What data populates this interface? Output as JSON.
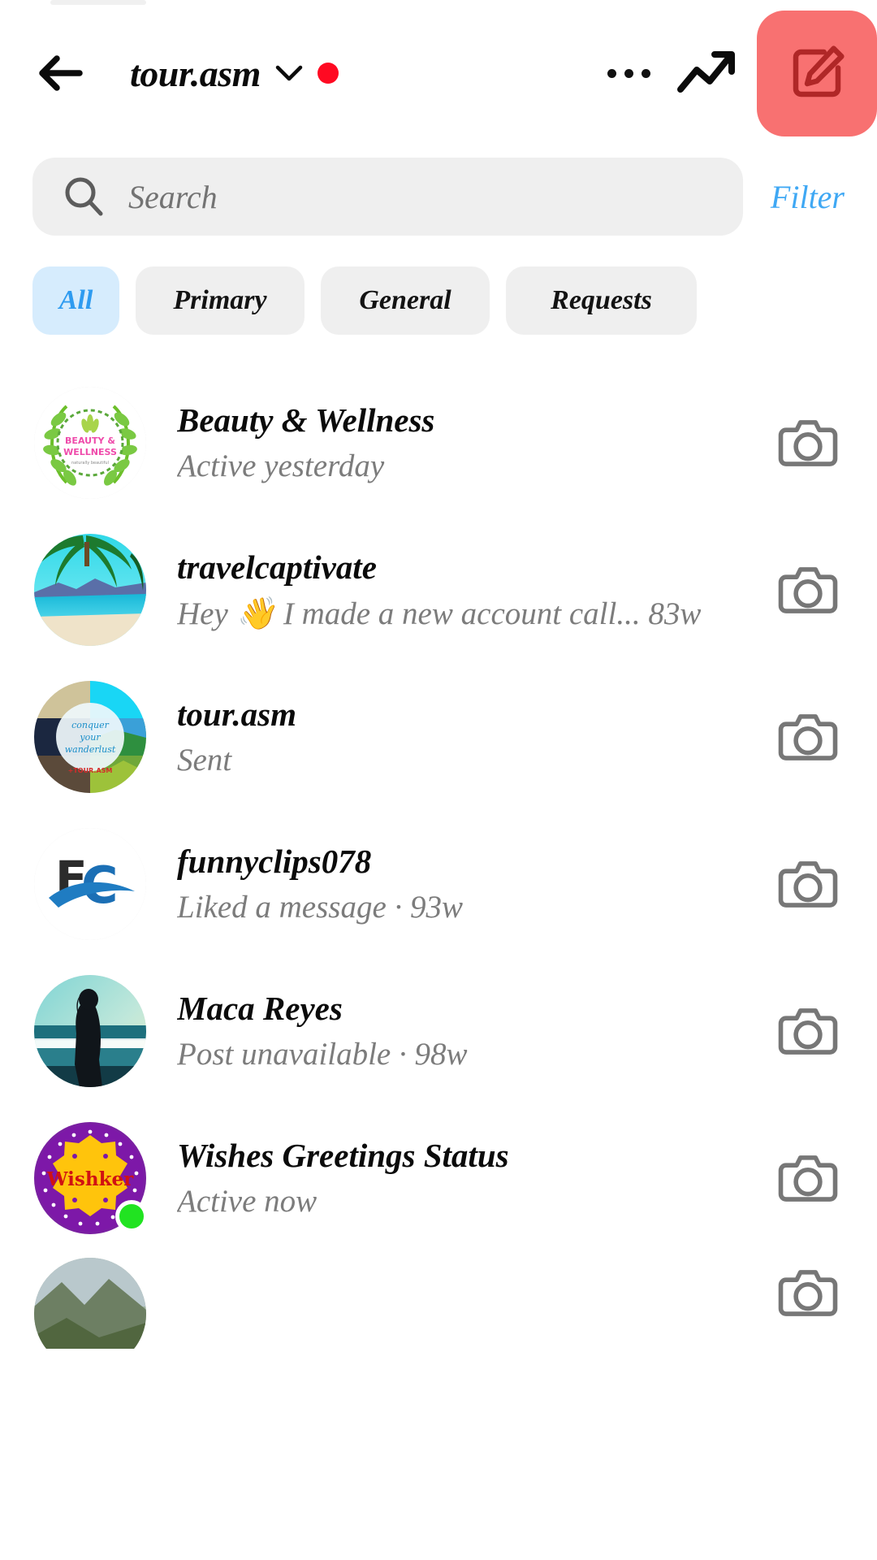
{
  "header": {
    "back_icon": "back-arrow-icon",
    "title": "tour.asm",
    "chevron_icon": "chevron-down-icon",
    "unread_dot": "red-dot-badge",
    "more_icon": "more-options-icon",
    "insights_icon": "trending-arrow-icon",
    "compose_icon": "compose-message-icon",
    "compose_bg": "#f87171"
  },
  "search": {
    "icon": "search-icon",
    "placeholder": "Search",
    "value": "",
    "filter_label": "Filter",
    "filter_color": "#3fa8f4"
  },
  "tabs": {
    "active_bg": "#d6ecfd",
    "active_color": "#2e9bf0",
    "items": [
      {
        "label": "All",
        "active": true
      },
      {
        "label": "Primary",
        "active": false
      },
      {
        "label": "General",
        "active": false
      },
      {
        "label": "Requests",
        "active": false
      }
    ]
  },
  "conversations": [
    {
      "name": "Beauty & Wellness",
      "preview": "Active yesterday",
      "avatar": "laurel-wreath-logo",
      "online": false,
      "camera_icon": "camera-icon"
    },
    {
      "name": "travelcaptivate",
      "preview": "Hey 👋 I made a new account call... 83w",
      "avatar": "tropical-beach-photo",
      "online": false,
      "camera_icon": "camera-icon"
    },
    {
      "name": "tour.asm",
      "preview": "Sent",
      "avatar": "conquer-your-wanderlust-collage",
      "online": false,
      "camera_icon": "camera-icon"
    },
    {
      "name": "funnyclips078",
      "preview": "Liked a message · 93w",
      "avatar": "fc-swoosh-logo",
      "online": false,
      "camera_icon": "camera-icon"
    },
    {
      "name": "Maca Reyes",
      "preview": "Post unavailable · 98w",
      "avatar": "ocean-silhouette-photo",
      "online": false,
      "camera_icon": "camera-icon"
    },
    {
      "name": "Wishes Greetings Status",
      "preview": "Active now",
      "avatar": "wishker-badge-logo",
      "online": true,
      "camera_icon": "camera-icon"
    },
    {
      "name": "",
      "preview": "",
      "avatar": "landscape-photo",
      "online": false,
      "camera_icon": "camera-icon"
    }
  ]
}
